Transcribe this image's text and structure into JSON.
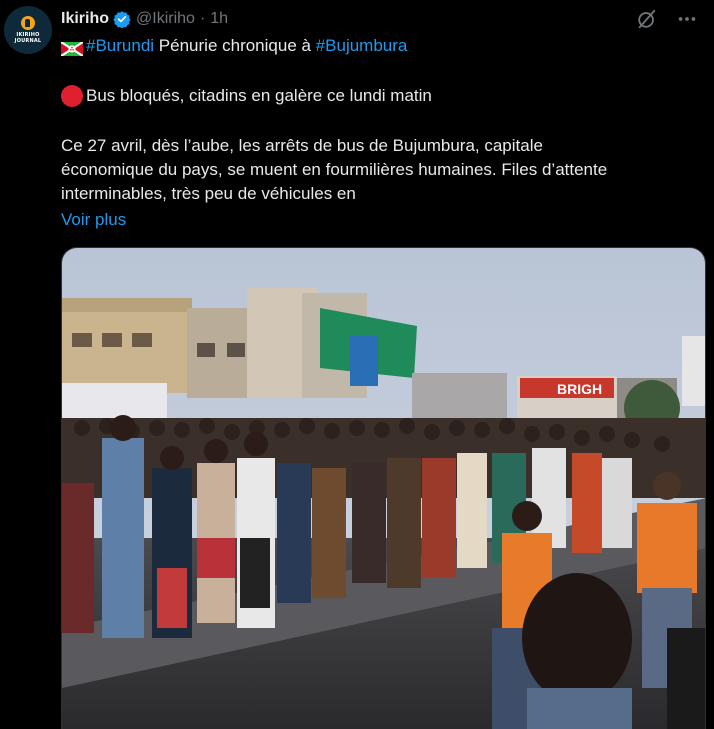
{
  "avatar": {
    "brand_text": "IKIRIHO JOURNAL"
  },
  "header": {
    "name": "Ikiriho",
    "handle": "@Ikiriho",
    "separator": "·",
    "time": "1h"
  },
  "post": {
    "line1": {
      "hashtag_1": "#Burundi",
      "text": "Pénurie chronique à",
      "hashtag_2": "#Bujumbura"
    },
    "line2": "Bus bloqués, citadins en galère ce lundi matin",
    "paragraph": [
      "Ce 27 avril, dès l’aube, les arrêts de bus de Bujumbura, capitale",
      "économique du pays, se muent en fourmilières humaines. Files d’attente",
      "interminables, très peu de véhicules en"
    ],
    "show_more": "Voir plus"
  },
  "photo": {
    "billboard": "BRIGH"
  },
  "icons": [
    "verified-badge-icon",
    "grok-icon",
    "more-icon",
    "burundi-flag-icon",
    "red-circle-icon"
  ],
  "colors": {
    "link": "#1d9bf0",
    "muted": "#71767b",
    "text": "#e7e9ea",
    "background": "#000000",
    "red_dot": "#e0202e"
  }
}
